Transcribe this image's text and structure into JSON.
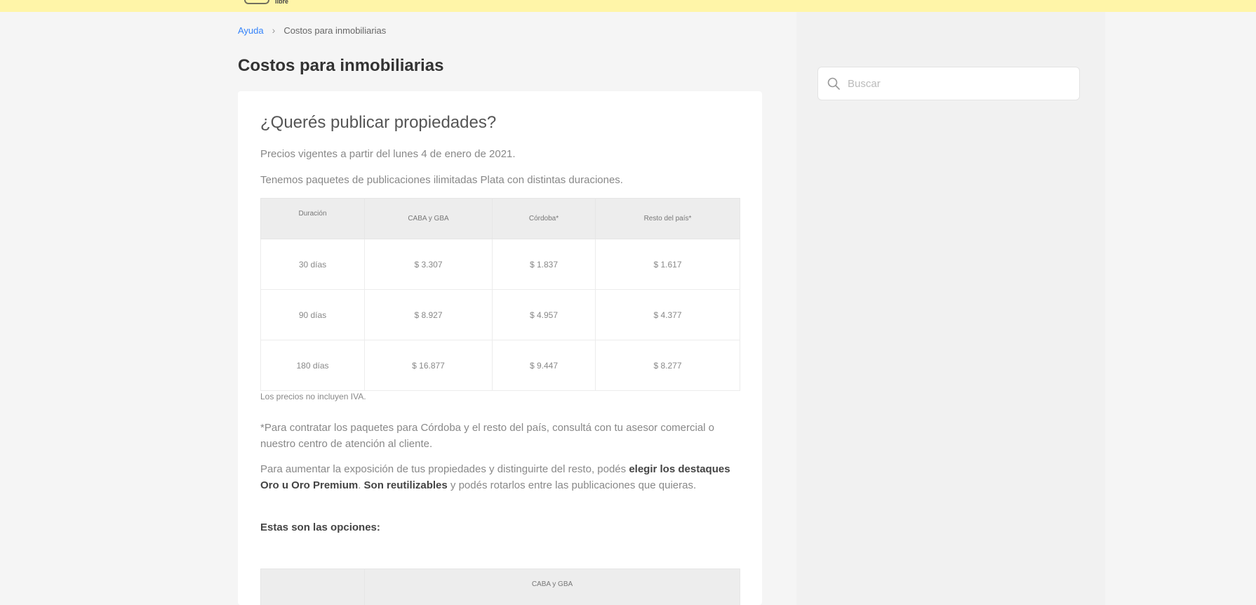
{
  "header": {
    "logo_text": "libre"
  },
  "breadcrumb": {
    "home": "Ayuda",
    "separator": "›",
    "current": "Costos para inmobiliarias"
  },
  "page_title": "Costos para inmobiliarias",
  "search": {
    "placeholder": "Buscar",
    "value": ""
  },
  "article": {
    "heading": "¿Querés publicar propiedades?",
    "intro1": "Precios vigentes a partir del lunes 4 de enero de 2021.",
    "intro2": "Tenemos paquetes de publicaciones ilimitadas Plata con distintas duraciones.",
    "table": {
      "headers": [
        "Duración",
        "CABA y GBA",
        "Córdoba*",
        "Resto del país*"
      ],
      "rows": [
        [
          "30 días",
          "$ 3.307",
          "$ 1.837",
          "$ 1.617"
        ],
        [
          "90 días",
          "$ 8.927",
          "$ 4.957",
          "$ 4.377"
        ],
        [
          "180 días",
          "$ 16.877",
          "$ 9.447",
          "$ 8.277"
        ]
      ]
    },
    "note": "Los precios no incluyen IVA.",
    "footnote": "*Para contratar los paquetes para Córdoba y el resto del país, consultá con tu asesor comercial o nuestro centro de atención al cliente.",
    "para_prefix": "Para aumentar la exposición de tus propiedades y distinguirte del resto, podés ",
    "para_bold1": "elegir los destaques Oro u Oro Premium",
    "para_mid": ". ",
    "para_bold2": "Son reutilizables",
    "para_suffix": " y podés rotarlos entre las publicaciones que quieras.",
    "options_label": "Estas son las opciones:",
    "table2_header": "CABA y GBA"
  }
}
